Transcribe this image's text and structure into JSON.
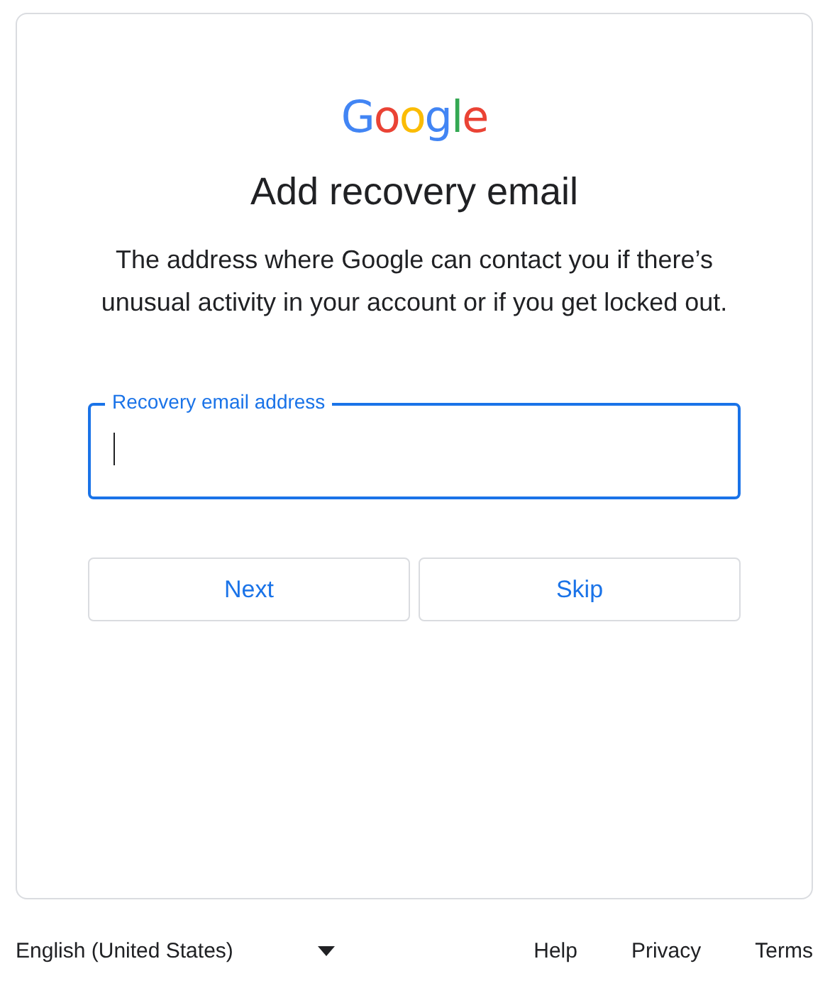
{
  "logo": "Google",
  "title": "Add recovery email",
  "description": "The address where Google can contact you if there’s unusual activity in your account or if you get locked out.",
  "field": {
    "label": "Recovery email address",
    "focused": true
  },
  "buttons": [
    "Next",
    "Skip"
  ],
  "footer": {
    "language": "English (United States)",
    "links": [
      "Help",
      "Privacy",
      "Terms"
    ]
  }
}
